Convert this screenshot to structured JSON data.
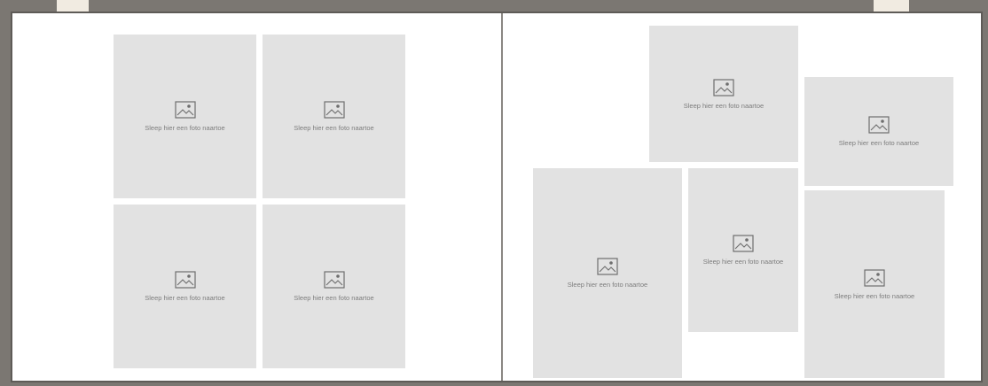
{
  "colors": {
    "frame": "#7b7772",
    "page": "#ffffff",
    "placeholder": "#e2e2e2",
    "placeholder_text": "#7d7d7d",
    "decoration": "#f1ebe1"
  },
  "slot_icon": "image-placeholder-icon",
  "left_page": {
    "slots": [
      {
        "label": "Sleep hier een foto naartoe"
      },
      {
        "label": "Sleep hier een foto naartoe"
      },
      {
        "label": "Sleep hier een foto naartoe"
      },
      {
        "label": "Sleep hier een foto naartoe"
      }
    ]
  },
  "right_page": {
    "slots": [
      {
        "label": "Sleep hier een foto naartoe"
      },
      {
        "label": "Sleep hier een foto naartoe"
      },
      {
        "label": "Sleep hier een foto naartoe"
      },
      {
        "label": "Sleep hier een foto naartoe"
      },
      {
        "label": "Sleep hier een foto naartoe"
      }
    ]
  }
}
